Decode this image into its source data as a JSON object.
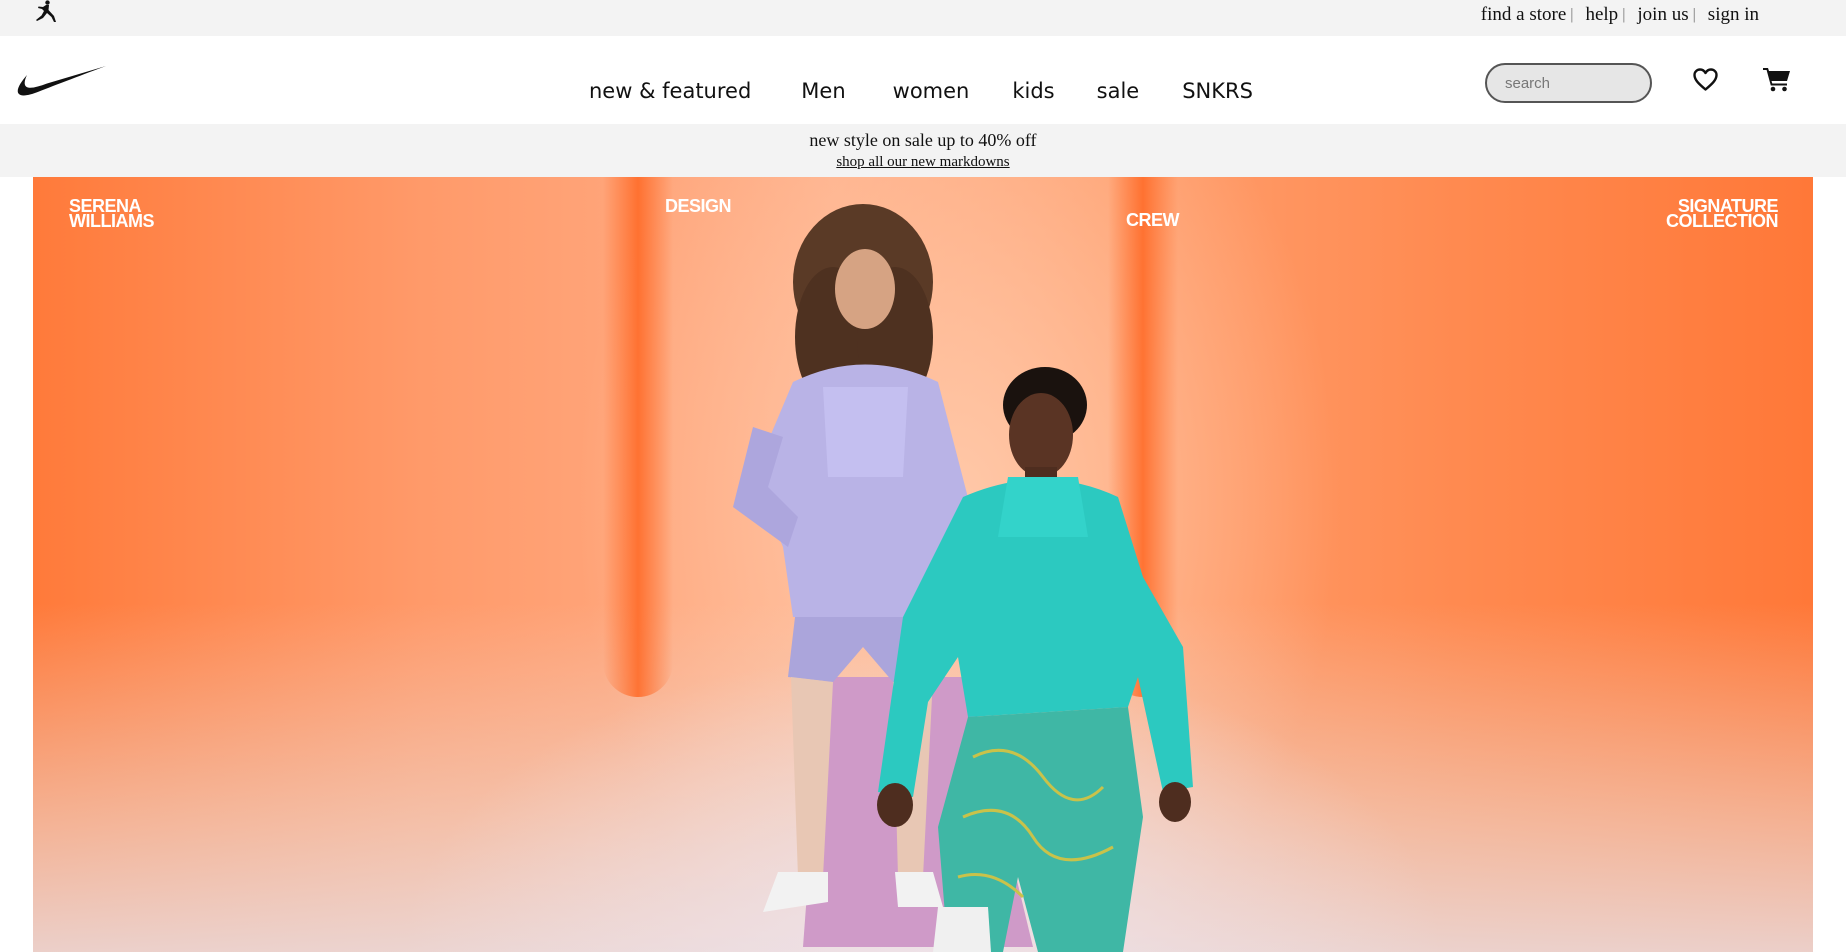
{
  "utility_bar": {
    "links": [
      {
        "label": "find a store"
      },
      {
        "label": "help"
      },
      {
        "label": "join us"
      },
      {
        "label": "sign in"
      }
    ],
    "separator": "|",
    "brand_icon": "jordan-jumpman-icon"
  },
  "header": {
    "logo_icon": "nike-swoosh-icon",
    "nav": [
      "new & featured",
      "Men",
      "women",
      "kids",
      "sale",
      "SNKRS"
    ],
    "search": {
      "placeholder": "search",
      "value": ""
    },
    "icons": [
      "heart-icon",
      "cart-icon"
    ]
  },
  "promo": {
    "text": "new style on sale up to 40% off",
    "link": "shop all our new markdowns"
  },
  "hero": {
    "labels": {
      "left": [
        "SERENA",
        "WILLIAMS"
      ],
      "design": "DESIGN",
      "crew": "CREW",
      "right": [
        "SIGNATURE",
        "COLLECTION"
      ]
    },
    "colors": {
      "background_orange": "#ff7a3a",
      "lavender_outfit": "#b9b3e6",
      "teal_outfit": "#2cc9c0"
    }
  }
}
